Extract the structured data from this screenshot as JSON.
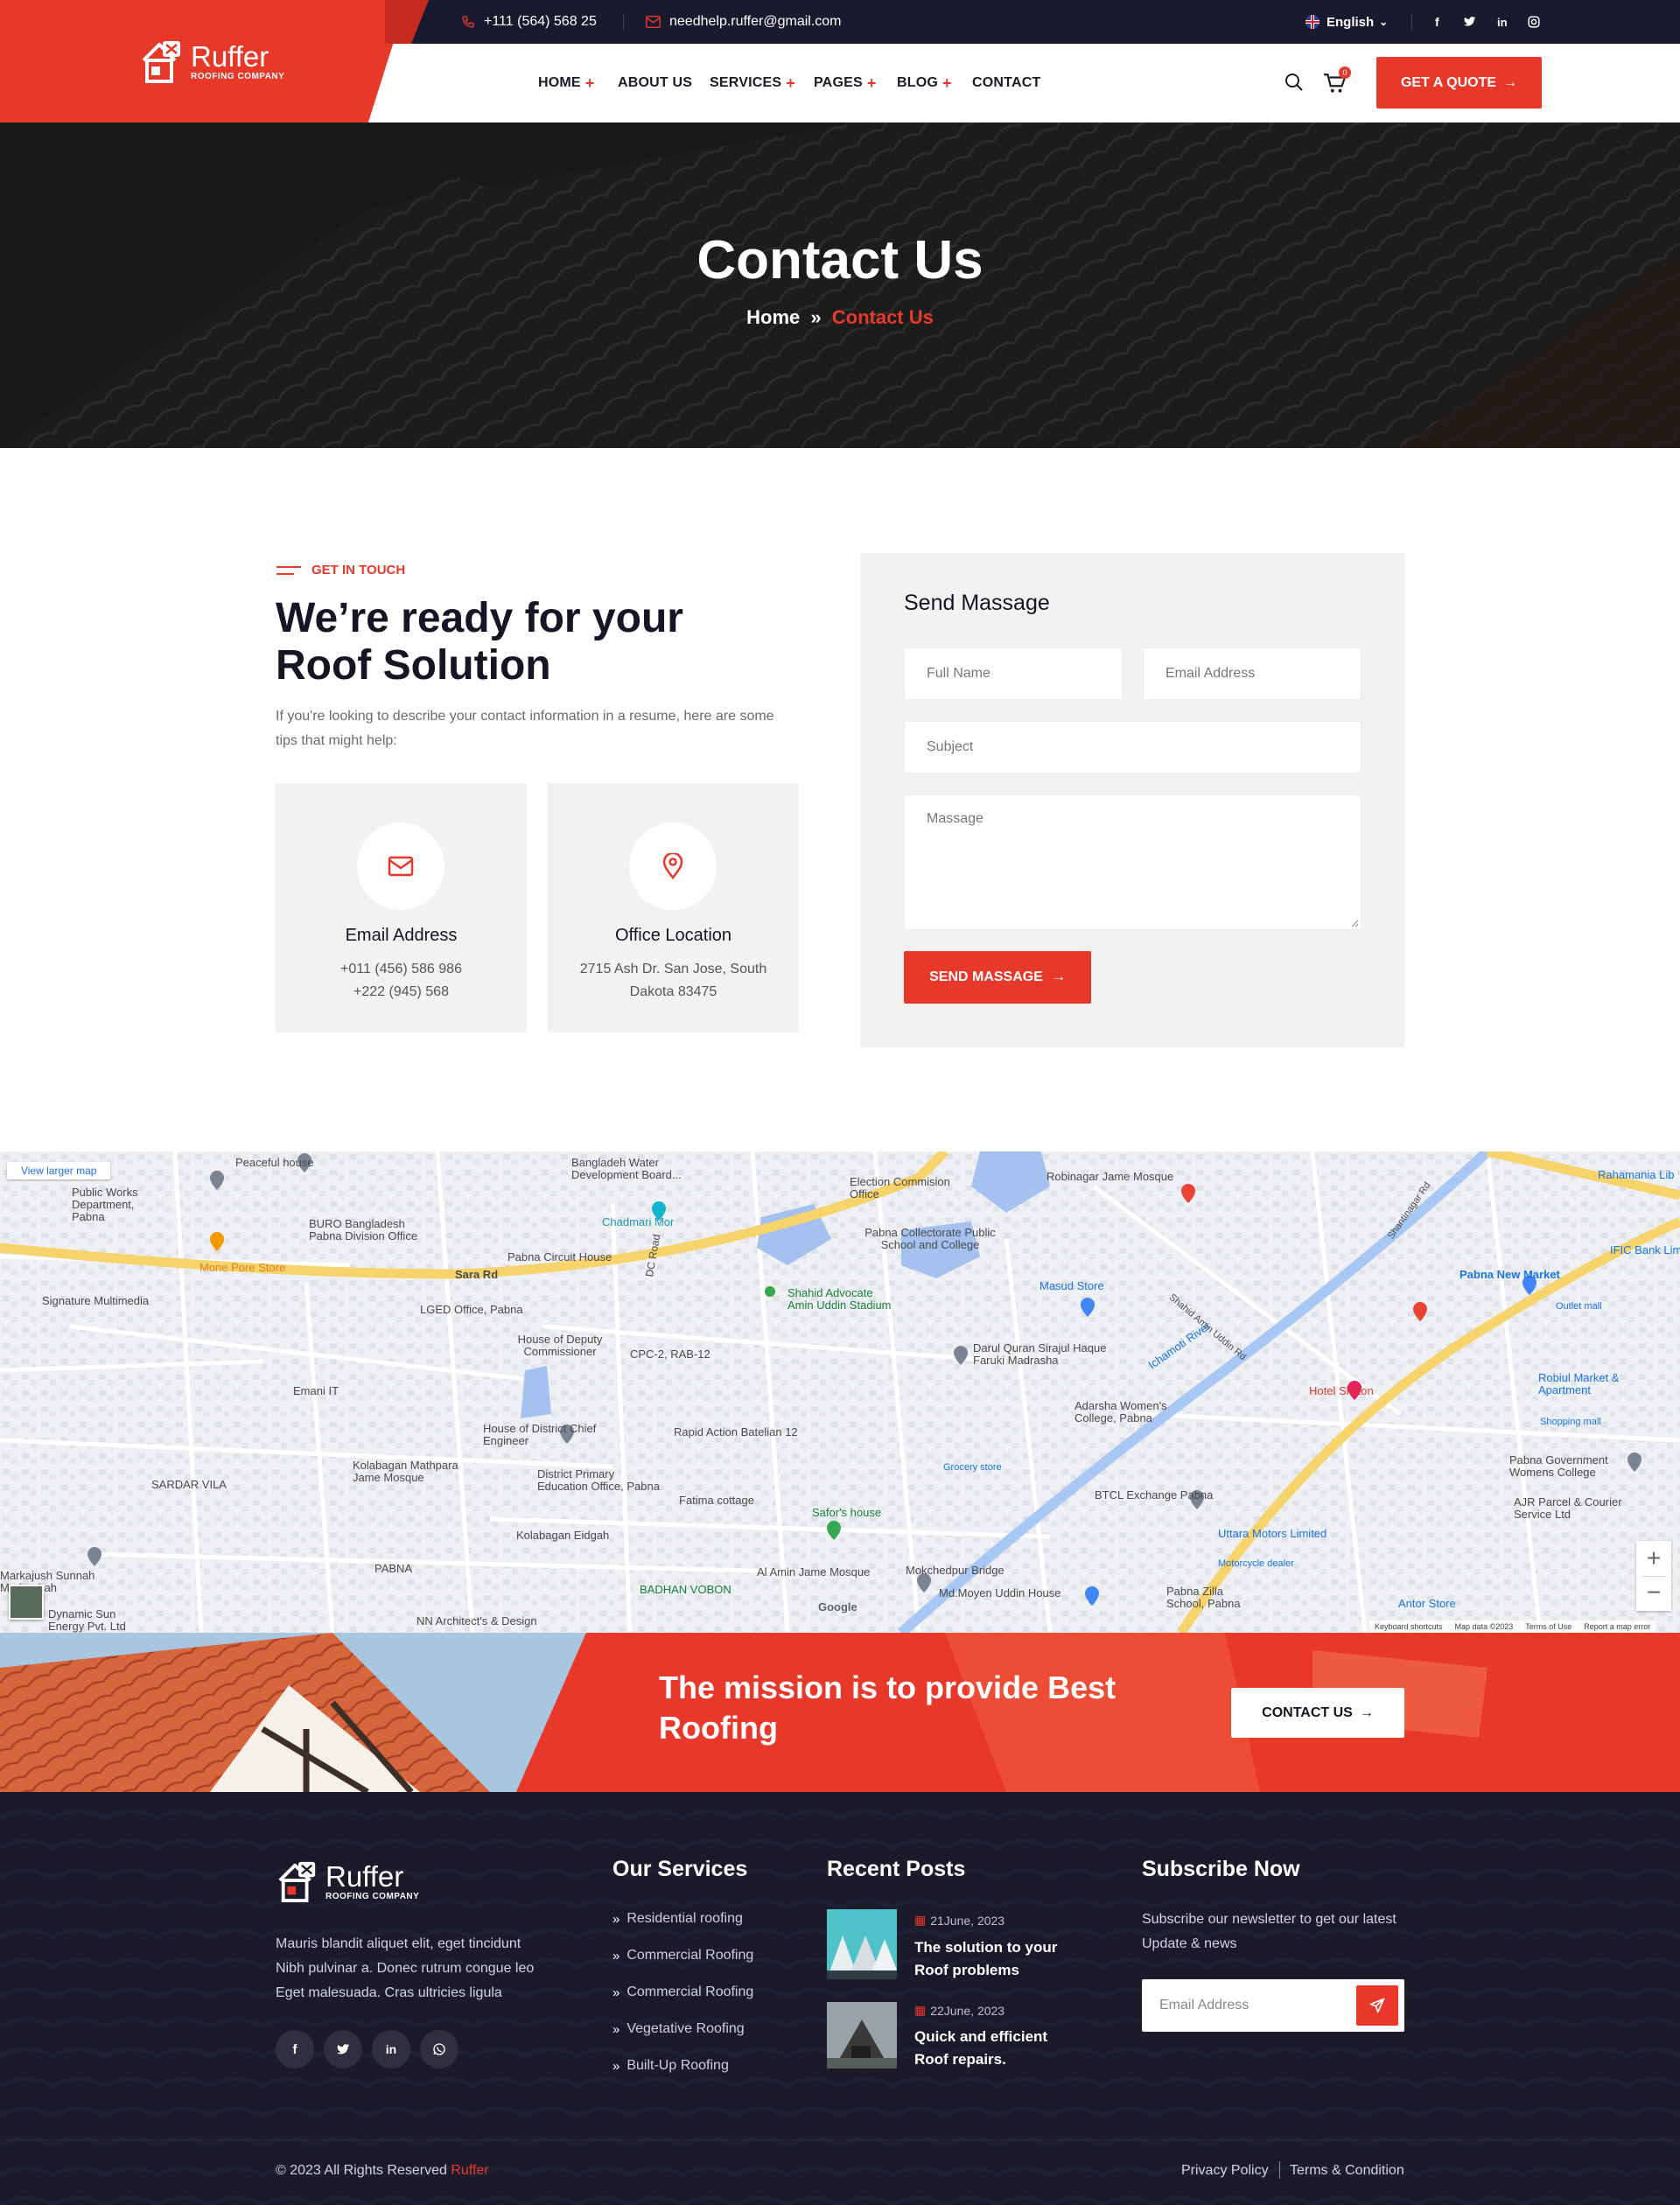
{
  "topbar": {
    "phone": "+111 (564) 568 25",
    "email": "needhelp.ruffer@gmail.com",
    "language": "English"
  },
  "brand": {
    "name": "Ruffer",
    "tagline": "ROOFING COMPANY",
    "accent": "#e8382a",
    "dark": "#1a1a2e"
  },
  "nav": {
    "home": "HOME",
    "about": "ABOUT US",
    "services": "SERVICES",
    "pages": "PAGES",
    "blog": "BLOG",
    "contact": "CONTACT",
    "cart_count": "0",
    "quote_button": "GET A QUOTE"
  },
  "hero": {
    "title": "Contact Us",
    "crumb_home": "Home",
    "crumb_sep": "»",
    "crumb_current": "Contact Us"
  },
  "contact": {
    "tag": "GET IN TOUCH",
    "headline": "We’re ready for your Roof Solution",
    "intro": "If you're looking to describe your contact information in a resume, here are some tips that might help:",
    "cards": [
      {
        "title": "Email Address",
        "icon": "envelope-icon",
        "lines": [
          "+011 (456) 586 986",
          "+222 (945) 568"
        ]
      },
      {
        "title": "Office Location",
        "icon": "map-pin-icon",
        "lines": [
          "2715 Ash Dr. San Jose, South",
          "Dakota 83475"
        ]
      }
    ]
  },
  "form": {
    "title": "Send Massage",
    "full_name_placeholder": "Full Name",
    "email_placeholder": "Email Address",
    "subject_placeholder": "Subject",
    "message_placeholder": "Massage",
    "submit": "SEND MASSAGE"
  },
  "map": {
    "view_larger": "View larger map",
    "labels": [
      "Peaceful house",
      "Bangladeh Water Development Board...",
      "Election Commision Office",
      "Robinagar Jame Mosque",
      "Public Works Department, Pabna",
      "BURO Bangladesh Pabna Division Office",
      "Chadmari Mor",
      "Pabna Collectorate Public School and College",
      "Mone Pore Store",
      "Pabna Circuit House",
      "Sara Rd",
      "Shahid Advocate Amin Uddin Stadium",
      "Masud Store",
      "Pabna New Market",
      "Signature Multimedia",
      "LGED Office, Pabna",
      "DC Road",
      "House of Deputy Commissioner",
      "CPC-2, RAB-12",
      "Darul Quran Sirajul Haque Faruki Madrasha",
      "Ichamoti River",
      "Hotel Shilton",
      "Robiul Market & Apartment",
      "Emani IT",
      "House of District Chief Engineer",
      "Rapid Action Batelian 12",
      "Adarsha Women's College, Pabna",
      "Kolabagan Mathpara Jame Mosque",
      "District Primary Education Office, Pabna",
      "Fatima cottage",
      "Grocery store",
      "BTCL Exchange Pabna",
      "Pabna Government Womens College",
      "SARDAR VILA",
      "Safor's house",
      "Kolabagan Eidgah",
      "Uttara Motors Limited",
      "AJR Parcel & Courier Service Ltd",
      "PABNA",
      "Al Amin Jame Mosque",
      "Mokchedpur Bridge",
      "BADHAN VOBON",
      "Md.Moyen Uddin House",
      "Pabna Zilla School, Pabna",
      "Antor Store",
      "NN Architect's & Design",
      "Dynamic Sun Energy Pvt. Ltd",
      "Markajush Sunnah Madrashah",
      "Shantinagar Rd",
      "Shahid Amin Uddin Rd",
      "Rahamania Lib",
      "IFIC Bank Lim",
      "Outlet mall",
      "Shopping mall",
      "Motorcycle dealer"
    ],
    "footer_shortcuts": "Keyboard shortcuts",
    "footer_data": "Map data ©2023",
    "footer_terms": "Terms of Use",
    "footer_report": "Report a map error",
    "google": "Google"
  },
  "cta": {
    "title": "The mission is to provide Best Roofing",
    "button": "CONTACT US"
  },
  "footer": {
    "about": "Mauris blandit aliquet elit, eget tincidunt Nibh pulvinar a. Donec rutrum congue leo Eget malesuada. Cras ultricies ligula",
    "services_title": "Our Services",
    "services": [
      "Residential roofing",
      "Commercial Roofing",
      "Commercial Roofing",
      "Vegetative Roofing",
      "Built-Up Roofing"
    ],
    "posts_title": "Recent Posts",
    "posts": [
      {
        "date": "21June, 2023",
        "title": "The solution to your Roof problems"
      },
      {
        "date": "22June, 2023",
        "title": "Quick and efficient Roof repairs."
      }
    ],
    "subscribe_title": "Subscribe Now",
    "subscribe_text": "Subscribe our newsletter to get our latest Update & news",
    "subscribe_placeholder": "Email Address",
    "copyright_prefix": "© 2023 All Rights Reserved",
    "copyright_brand": "Ruffer",
    "privacy": "Privacy Policy",
    "terms": "Terms & Condition"
  }
}
